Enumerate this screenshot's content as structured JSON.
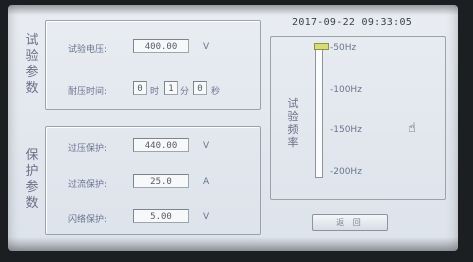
{
  "datetime": "2017-09-22 09:33:05",
  "test_params": {
    "title": "试验参数",
    "voltage_label": "试验电压:",
    "voltage_value": "400.00",
    "voltage_unit": "V",
    "duration_label": "耐压时间:",
    "hours": "0",
    "hour_unit": "时",
    "minutes": "1",
    "minute_unit": "分",
    "seconds": "0",
    "second_unit": "秒"
  },
  "protection_params": {
    "title": "保护参数",
    "overvoltage_label": "过压保护:",
    "overvoltage_value": "440.00",
    "overvoltage_unit": "V",
    "overcurrent_label": "过流保护:",
    "overcurrent_value": "25.0",
    "overcurrent_unit": "A",
    "flashover_label": "闪络保护:",
    "flashover_value": "5.00",
    "flashover_unit": "V"
  },
  "frequency": {
    "title": "试验频率",
    "ticks": [
      "50Hz",
      "100Hz",
      "150Hz",
      "200Hz"
    ],
    "selected": "50Hz",
    "slider_level": 0
  },
  "return_button": "返 回"
}
